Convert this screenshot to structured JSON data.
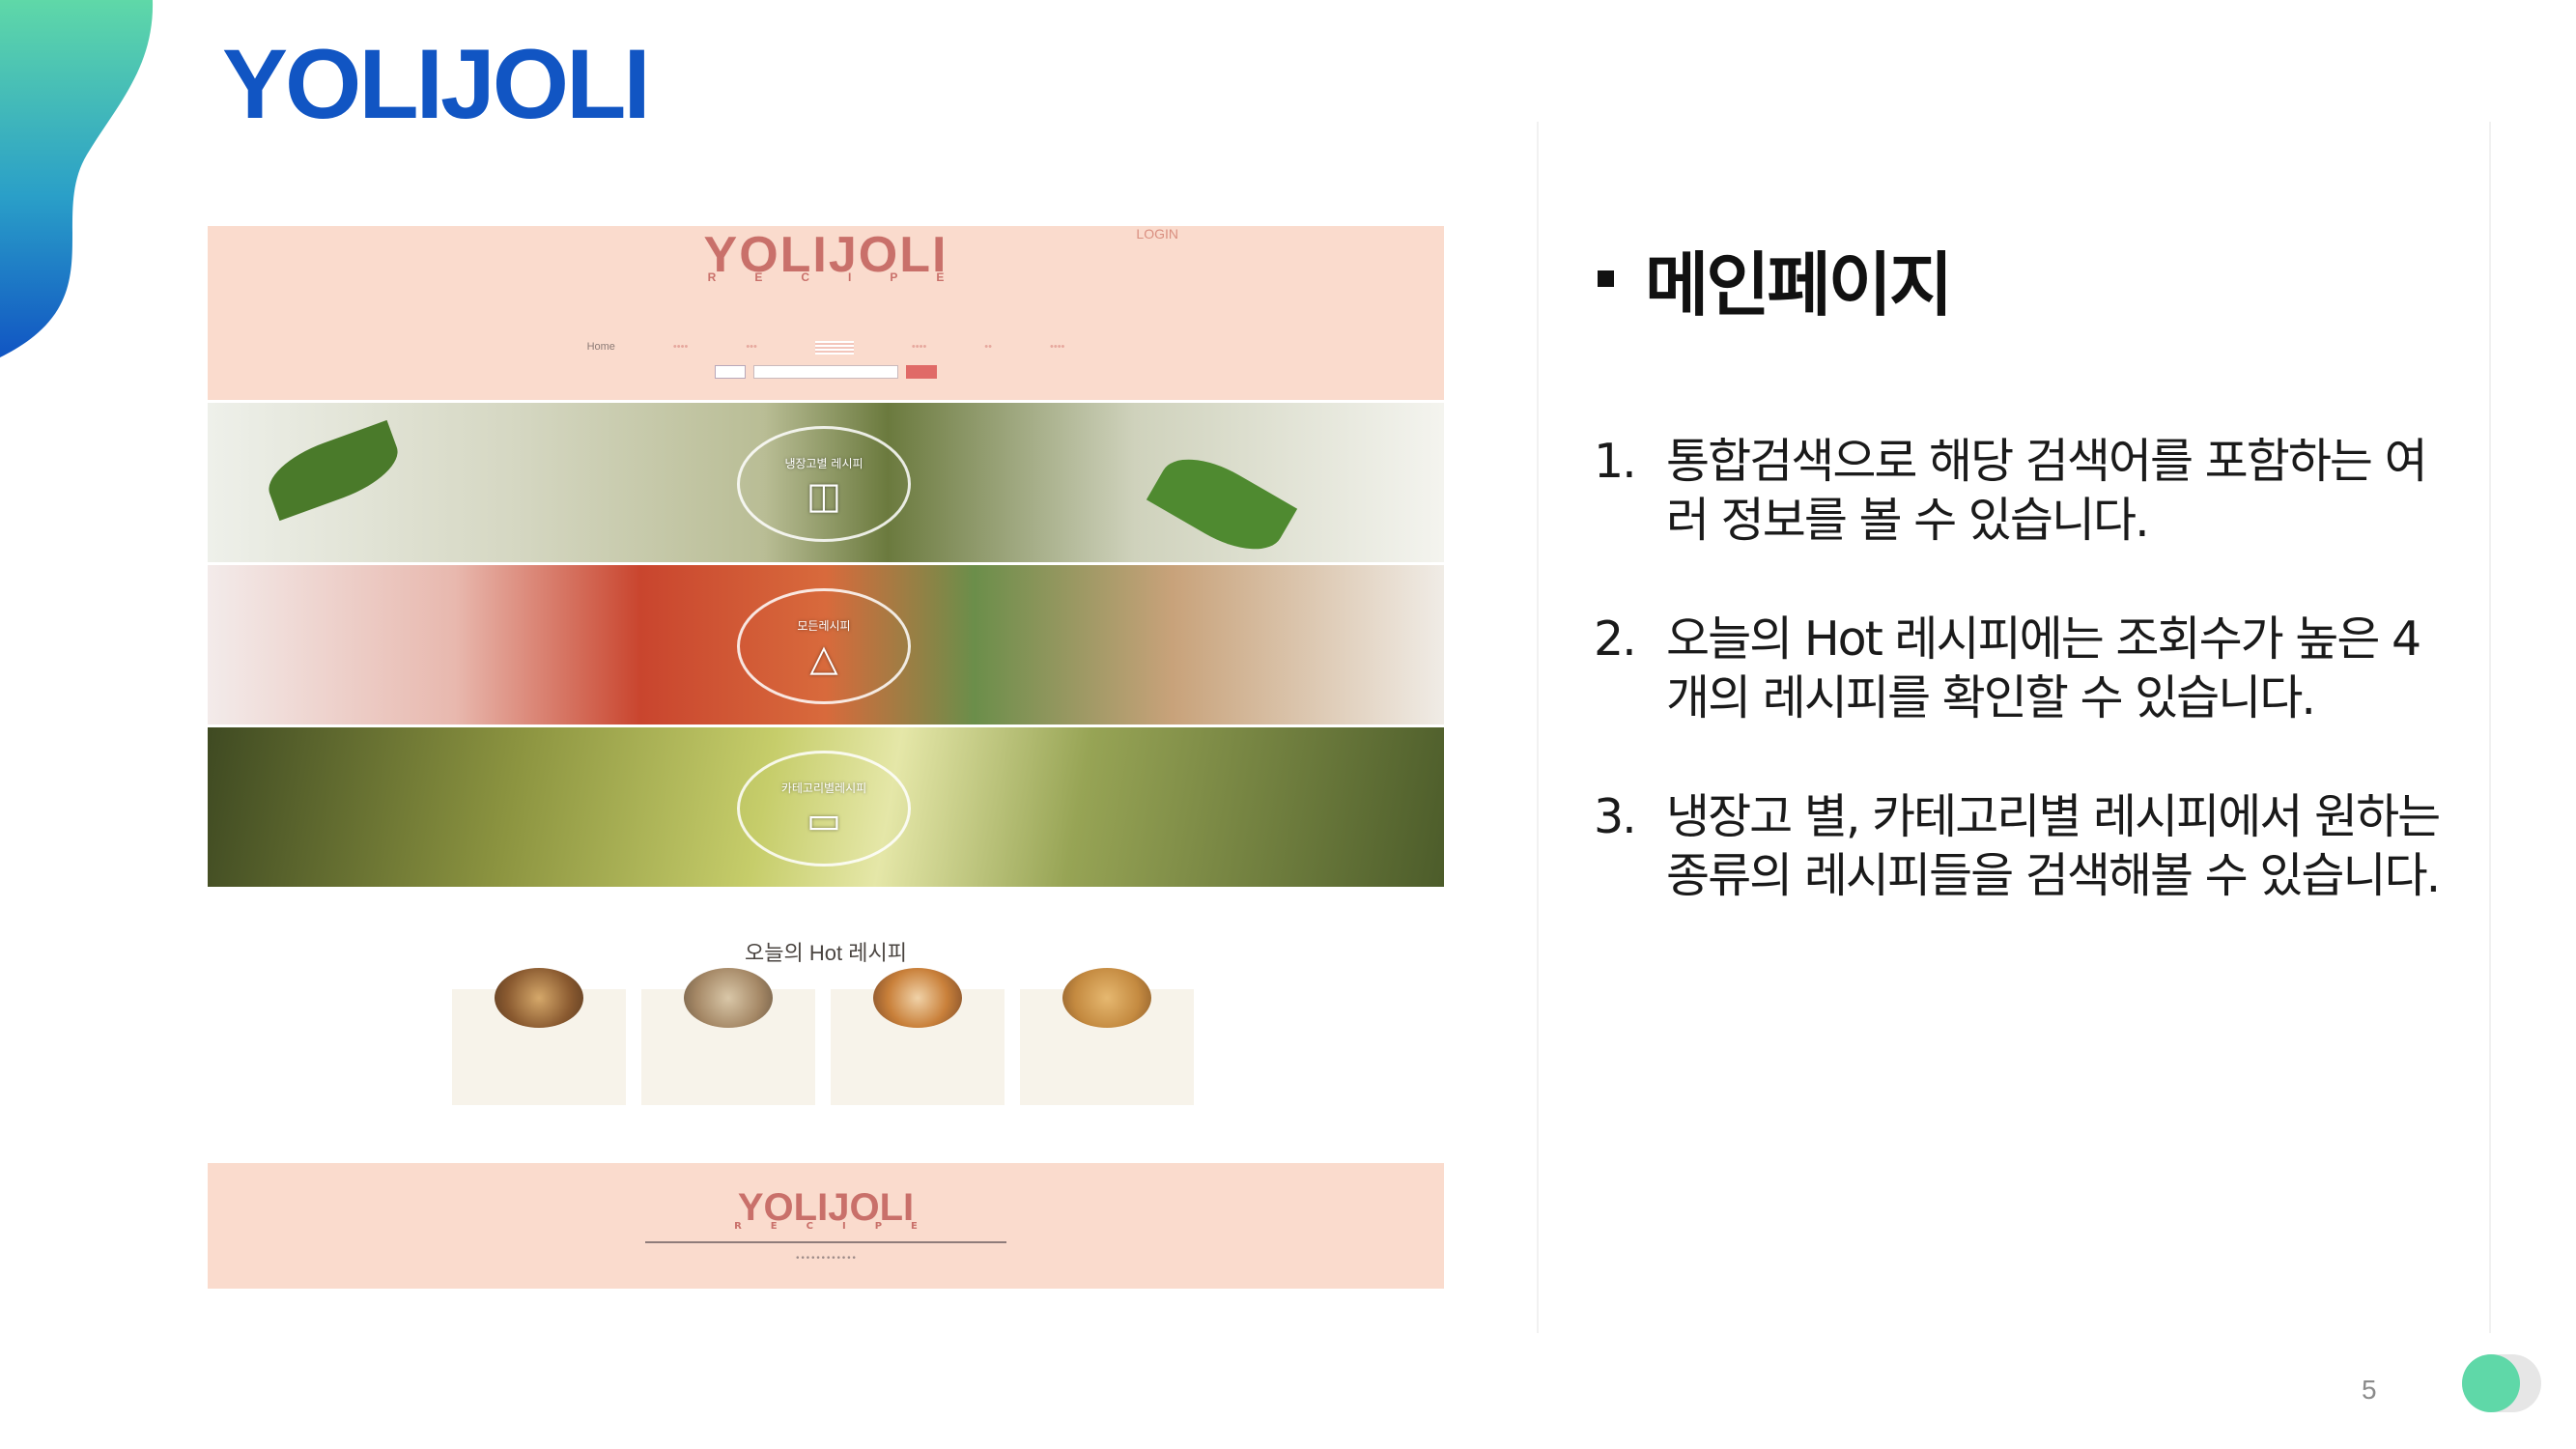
{
  "slide": {
    "title": "YOLIJOLI",
    "page_number": "5"
  },
  "colors": {
    "title_blue": "#1155c3",
    "blob_top": "#5fd8a8",
    "blob_bottom": "#1155c3",
    "site_pink": "#fadbcd",
    "site_logo": "#c9706a",
    "toggle_knob": "#5fd8a8"
  },
  "website": {
    "login": "LOGIN",
    "logo": "YOLIJOLI",
    "logo_sub": "RECIPE",
    "nav": [
      "Home",
      "",
      "",
      "",
      "",
      "",
      ""
    ],
    "banners": [
      {
        "label": "냉장고별 레시피",
        "icon": "fridge-icon"
      },
      {
        "label": "모든레시피",
        "icon": "cloche-icon"
      },
      {
        "label": "카테고리별레시피",
        "icon": "box-icon"
      }
    ],
    "hot_title": "오늘의 Hot 레시피",
    "hot_items": [
      {
        "name": "",
        "desc": ""
      },
      {
        "name": "",
        "desc": ""
      },
      {
        "name": "",
        "desc": ""
      },
      {
        "name": "",
        "desc": ""
      }
    ],
    "footer_logo": "YOLIJOLI",
    "footer_sub": "RECIPE"
  },
  "panel": {
    "heading": "메인페이지",
    "items": [
      {
        "num": "1.",
        "text": "통합검색으로 해당 검색어를 포함하는 여러 정보를 볼 수 있습니다."
      },
      {
        "num": "2.",
        "text": "오늘의 Hot 레시피에는 조회수가 높은 4개의 레시피를 확인할 수 있습니다."
      },
      {
        "num": "3.",
        "text": "냉장고 별, 카테고리별 레시피에서 원하는 종류의 레시피들을 검색해볼 수 있습니다."
      }
    ]
  }
}
